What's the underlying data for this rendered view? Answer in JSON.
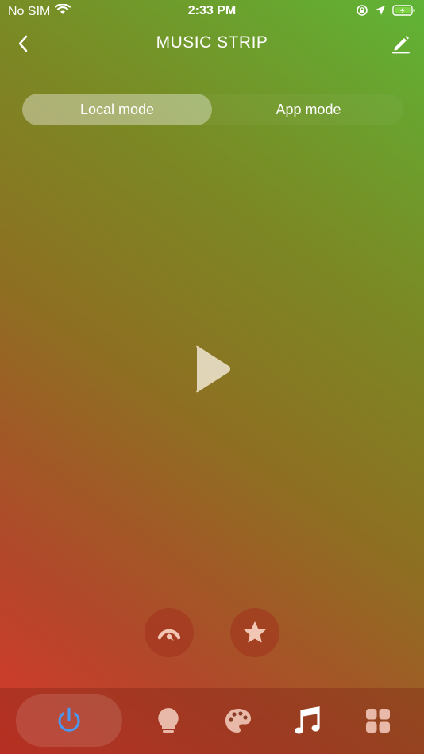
{
  "status_bar": {
    "carrier": "No SIM",
    "time": "2:33 PM"
  },
  "nav": {
    "title": "MUSIC STRIP"
  },
  "mode_switch": {
    "local_label": "Local mode",
    "app_label": "App mode",
    "selected": "Local mode"
  },
  "colors": {
    "power_icon": "#4a9af5",
    "active_tab_icon": "#ffffff",
    "inactive_tab_icon": "#e8b8a8"
  },
  "bottom_tabs": [
    {
      "name": "power",
      "icon": "power-icon",
      "active": true
    },
    {
      "name": "light",
      "icon": "bulb-icon",
      "active": false
    },
    {
      "name": "color",
      "icon": "palette-icon",
      "active": false
    },
    {
      "name": "music",
      "icon": "music-note-icon",
      "active": true
    },
    {
      "name": "scene",
      "icon": "grid-icon",
      "active": false
    }
  ]
}
